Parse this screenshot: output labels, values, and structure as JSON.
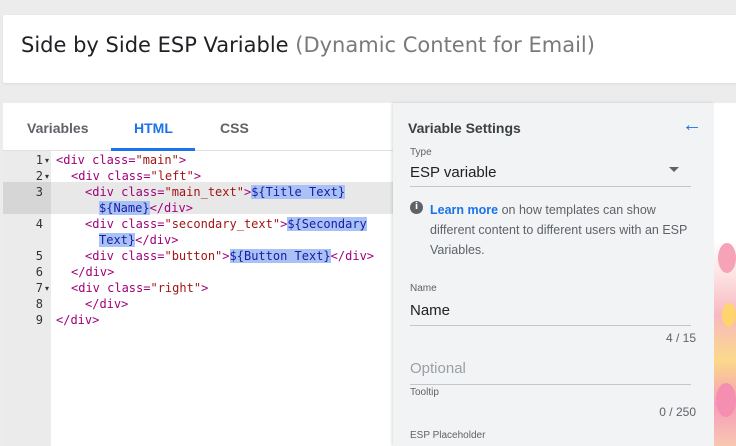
{
  "header": {
    "title": "Side by Side ESP Variable",
    "subtitle": "(Dynamic Content for Email)"
  },
  "editor": {
    "tabs": [
      {
        "label": "Variables"
      },
      {
        "label": "HTML"
      },
      {
        "label": "CSS"
      }
    ],
    "active_tab": "HTML",
    "line_numbers": [
      "1",
      "2",
      "3",
      "4",
      "5",
      "6",
      "7",
      "8",
      "9"
    ],
    "code": {
      "l1_open": "<div ",
      "l1_attr": "class=",
      "l1_str": "\"main\"",
      "l1_close": ">",
      "l2_open": "<div ",
      "l2_attr": "class=",
      "l2_str": "\"left\"",
      "l2_close": ">",
      "l3_open": "<div ",
      "l3_attr": "class=",
      "l3_str": "\"main_text\"",
      "l3_close": ">",
      "l3_var": "${Title Text}",
      "l3b_var": "${Name}",
      "l3b_close": "</div>",
      "l4_open": "<div ",
      "l4_attr": "class=",
      "l4_str": "\"secondary_text\"",
      "l4_close": ">",
      "l4_var": "${Secondary",
      "l4b_var": "Text}",
      "l4b_close": "</div>",
      "l5_open": "<div ",
      "l5_attr": "class=",
      "l5_str": "\"button\"",
      "l5_close": ">",
      "l5_var": "${Button Text}",
      "l5_end": "</div>",
      "l6": "</div>",
      "l7_open": "<div ",
      "l7_attr": "class=",
      "l7_str": "\"right\"",
      "l7_close": ">",
      "l8": "</div>",
      "l9": "</div>"
    }
  },
  "settings": {
    "title": "Variable Settings",
    "back_icon": "arrow-left-icon",
    "type_label": "Type",
    "type_value": "ESP variable",
    "info_link": "Learn more",
    "info_text": " on how templates can show different content to different users with an ESP Variables.",
    "name_label": "Name",
    "name_value": "Name",
    "name_counter": "4 / 15",
    "tooltip_placeholder": "Optional",
    "tooltip_label": "Tooltip",
    "tooltip_counter": "0 / 250",
    "esp_placeholder_label": "ESP Placeholder"
  },
  "colors": {
    "accent": "#1a73e8",
    "tag": "#a0007a",
    "string": "#a31515",
    "selection": "#a8c2f5"
  }
}
